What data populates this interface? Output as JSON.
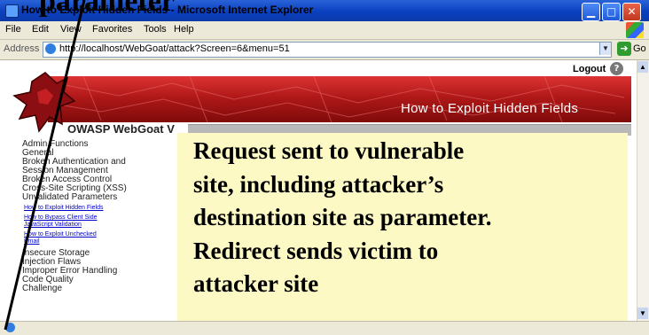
{
  "window": {
    "title": "How to Exploit Hidden Fields - Microsoft Internet Explorer",
    "minimize_glyph": "▁",
    "maximize_glyph": "□",
    "close_glyph": "✕"
  },
  "slide": {
    "title_fragment": "parameter"
  },
  "menu": {
    "items": [
      "File",
      "Edit",
      "View",
      "Favorites",
      "Tools",
      "Help"
    ]
  },
  "address": {
    "label": "Address",
    "url": "http://localhost/WebGoat/attack?Screen=6&menu=51",
    "go_label": "Go"
  },
  "page": {
    "logout": "Logout",
    "help_glyph": "?",
    "banner_title": "How to Exploit Hidden Fields",
    "brand": "OWASP WebGoat V"
  },
  "lessons": {
    "categories_top": [
      "Admin Functions",
      "General",
      "Broken Authentication and",
      "Session Management",
      "Broken Access Control",
      "Cross-Site Scripting (XSS)",
      "Unvalidated Parameters"
    ],
    "sub_items": [
      "How to Exploit Hidden Fields",
      "How to Bypass Client Side",
      "JavaScript Validation",
      "How to Exploit Unchecked",
      "Email"
    ],
    "categories_bottom": [
      "Insecure Storage",
      "Injection Flaws",
      "Improper Error Handling",
      "Code Quality",
      "Challenge"
    ]
  },
  "callout": {
    "lines": [
      "Request sent to vulnerable",
      "site, including attacker’s",
      "destination site as parameter.",
      "Redirect sends victim to",
      "attacker site"
    ]
  },
  "icons": {
    "app": "ie-icon",
    "page": "ie-page-icon",
    "go": "green-arrow-icon",
    "help": "help-icon",
    "logo": "goat-logo",
    "status": "ie-status-icon"
  },
  "colors": {
    "banner": "#b01818",
    "callout": "#fdf9c4",
    "titlebar": "#0a3fbf"
  }
}
